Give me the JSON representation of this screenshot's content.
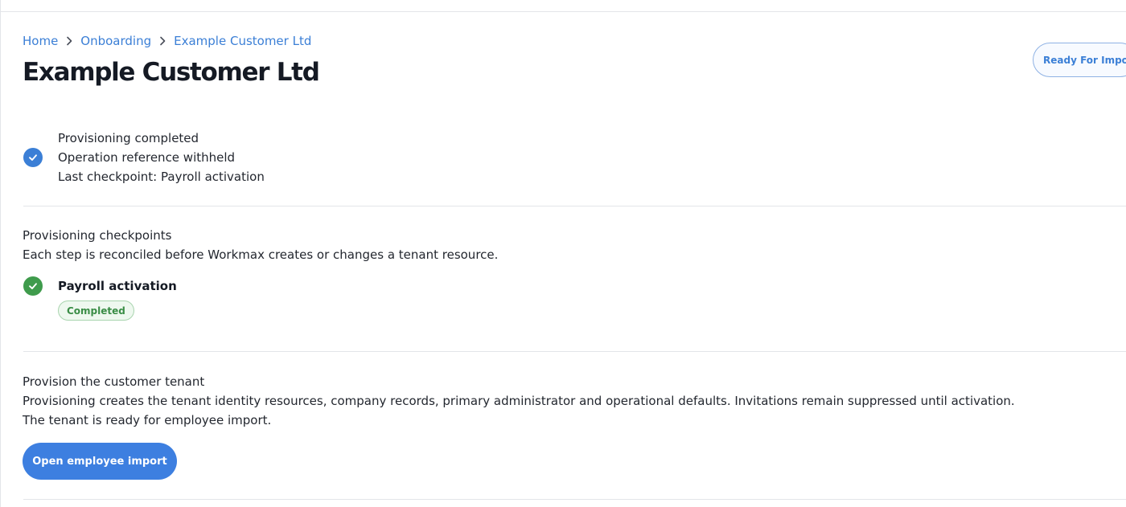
{
  "breadcrumb": {
    "items": [
      {
        "label": "Home"
      },
      {
        "label": "Onboarding"
      },
      {
        "label": "Example Customer Ltd"
      }
    ]
  },
  "header": {
    "title": "Example Customer Ltd",
    "status_label": "Ready For Import"
  },
  "summary": {
    "line1": "Provisioning completed",
    "line2": "Operation reference withheld",
    "line3": "Last checkpoint: Payroll activation"
  },
  "checkpoints": {
    "title": "Provisioning checkpoints",
    "description": "Each step is reconciled before Workmax creates or changes a tenant resource.",
    "items": [
      {
        "name": "Payroll activation",
        "state": "Completed"
      }
    ]
  },
  "provision": {
    "title": "Provision the customer tenant",
    "description": "Provisioning creates the tenant identity resources, company records, primary administrator and operational defaults. Invitations remain suppressed until activation.",
    "note": "The tenant is ready for employee import.",
    "button_label": "Open employee import"
  },
  "colors": {
    "accent": "#3b7fd6",
    "success": "#3f9b4c"
  },
  "icons": {
    "breadcrumb_separator": "chevron-right-icon",
    "summary_status": "check-circle-icon",
    "checkpoint_status": "check-circle-icon"
  }
}
